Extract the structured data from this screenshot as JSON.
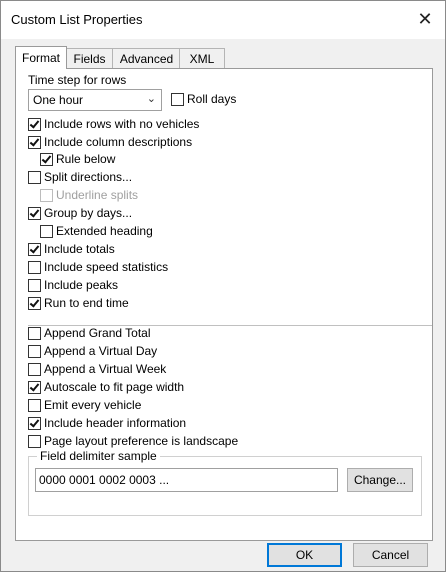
{
  "dialog": {
    "title": "Custom List Properties",
    "close_glyph": "✕"
  },
  "tabs": [
    {
      "label": "Format",
      "active": true
    },
    {
      "label": "Fields"
    },
    {
      "label": "Advanced"
    },
    {
      "label": "XML"
    }
  ],
  "format": {
    "time_step_label": "Time step for rows",
    "time_step_value": "One hour",
    "roll_days": {
      "label": "Roll days",
      "checked": false
    },
    "options": [
      {
        "id": "include_rows_no_vehicles",
        "label": "Include rows with no vehicles",
        "checked": true
      },
      {
        "id": "include_column_descriptions",
        "label": "Include column descriptions",
        "checked": true
      },
      {
        "id": "rule_below",
        "label": "Rule below",
        "checked": true
      },
      {
        "id": "split_directions",
        "label": "Split directions...",
        "checked": false
      },
      {
        "id": "underline_splits",
        "label": "Underline splits",
        "checked": false,
        "disabled": true
      },
      {
        "id": "group_by_days",
        "label": "Group by days...",
        "checked": true
      },
      {
        "id": "extended_heading",
        "label": "Extended heading",
        "checked": false
      },
      {
        "id": "include_totals",
        "label": "Include totals",
        "checked": true
      },
      {
        "id": "include_speed_statistics",
        "label": "Include speed statistics",
        "checked": false
      },
      {
        "id": "include_peaks",
        "label": "Include peaks",
        "checked": false
      },
      {
        "id": "run_to_end_time",
        "label": "Run to end time",
        "checked": true
      },
      {
        "id": "append_grand_total",
        "label": "Append Grand Total",
        "checked": false
      },
      {
        "id": "append_virtual_day",
        "label": "Append a Virtual Day",
        "checked": false
      },
      {
        "id": "append_virtual_week",
        "label": "Append a Virtual Week",
        "checked": false
      },
      {
        "id": "autoscale",
        "label": "Autoscale to fit page width",
        "checked": true
      },
      {
        "id": "emit_every_vehicle",
        "label": "Emit every vehicle",
        "checked": false
      },
      {
        "id": "include_header_information",
        "label": "Include header information",
        "checked": true
      },
      {
        "id": "landscape",
        "label": "Page layout preference is landscape",
        "checked": false
      }
    ],
    "field_delimiter": {
      "title": "Field delimiter sample",
      "value": "0000 0001 0002 0003  ...",
      "change_button": "Change..."
    }
  },
  "buttons": {
    "ok": "OK",
    "cancel": "Cancel"
  }
}
